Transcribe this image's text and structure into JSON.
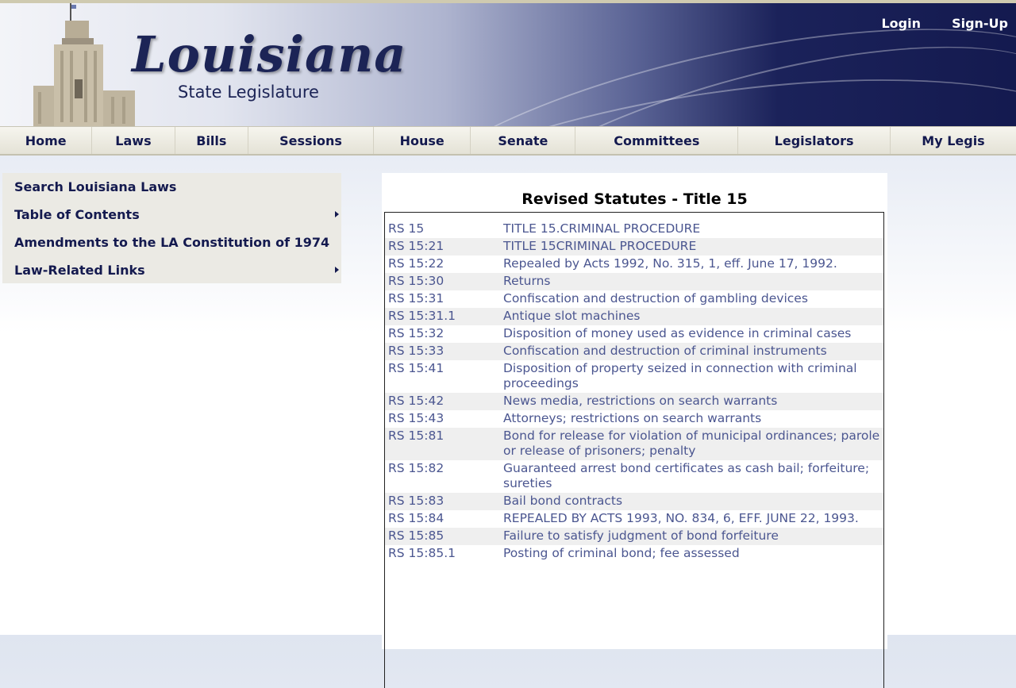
{
  "header": {
    "logo_title": "Louisiana",
    "logo_subtitle": "State Legislature",
    "login": "Login",
    "signup": "Sign-Up"
  },
  "nav": [
    "Home",
    "Laws",
    "Bills",
    "Sessions",
    "House",
    "Senate",
    "Committees",
    "Legislators",
    "My Legis"
  ],
  "sidebar": {
    "items": [
      {
        "label": "Search Louisiana Laws",
        "has_submenu": false
      },
      {
        "label": "Table of Contents",
        "has_submenu": true
      },
      {
        "label": "Amendments to the LA Constitution of 1974",
        "has_submenu": false
      },
      {
        "label": "Law-Related Links",
        "has_submenu": true
      }
    ]
  },
  "main": {
    "title": "Revised Statutes - Title 15",
    "rows": [
      {
        "code": "RS 15",
        "desc": "TITLE 15.CRIMINAL PROCEDURE"
      },
      {
        "code": "RS 15:21",
        "desc": "TITLE 15CRIMINAL PROCEDURE"
      },
      {
        "code": "RS 15:22",
        "desc": "Repealed by Acts 1992, No. 315, 1, eff. June 17, 1992."
      },
      {
        "code": "RS 15:30",
        "desc": "Returns"
      },
      {
        "code": "RS 15:31",
        "desc": "Confiscation and destruction of gambling devices"
      },
      {
        "code": "RS 15:31.1",
        "desc": "Antique slot machines"
      },
      {
        "code": "RS 15:32",
        "desc": "Disposition of money used as evidence in criminal cases"
      },
      {
        "code": "RS 15:33",
        "desc": "Confiscation and destruction of criminal instruments"
      },
      {
        "code": "RS 15:41",
        "desc": "Disposition of property seized in connection with criminal proceedings"
      },
      {
        "code": "RS 15:42",
        "desc": "News media, restrictions on search warrants"
      },
      {
        "code": "RS 15:43",
        "desc": "Attorneys; restrictions on search warrants"
      },
      {
        "code": "RS 15:81",
        "desc": "Bond for release for violation of municipal ordinances; parole or release of prisoners; penalty"
      },
      {
        "code": "RS 15:82",
        "desc": "Guaranteed arrest bond certificates as cash bail; forfeiture; sureties"
      },
      {
        "code": "RS 15:83",
        "desc": "Bail bond contracts"
      },
      {
        "code": "RS 15:84",
        "desc": "REPEALED BY ACTS 1993, NO. 834, 6, EFF. JUNE 22, 1993."
      },
      {
        "code": "RS 15:85",
        "desc": "Failure to satisfy judgment of bond forfeiture"
      },
      {
        "code": "RS 15:85.1",
        "desc": "Posting of criminal bond; fee assessed"
      }
    ]
  },
  "colors": {
    "header_dark": "#141a4f",
    "link": "#4b5690",
    "row_alt": "#efefef",
    "nav_bg": "#f6f5ee"
  }
}
